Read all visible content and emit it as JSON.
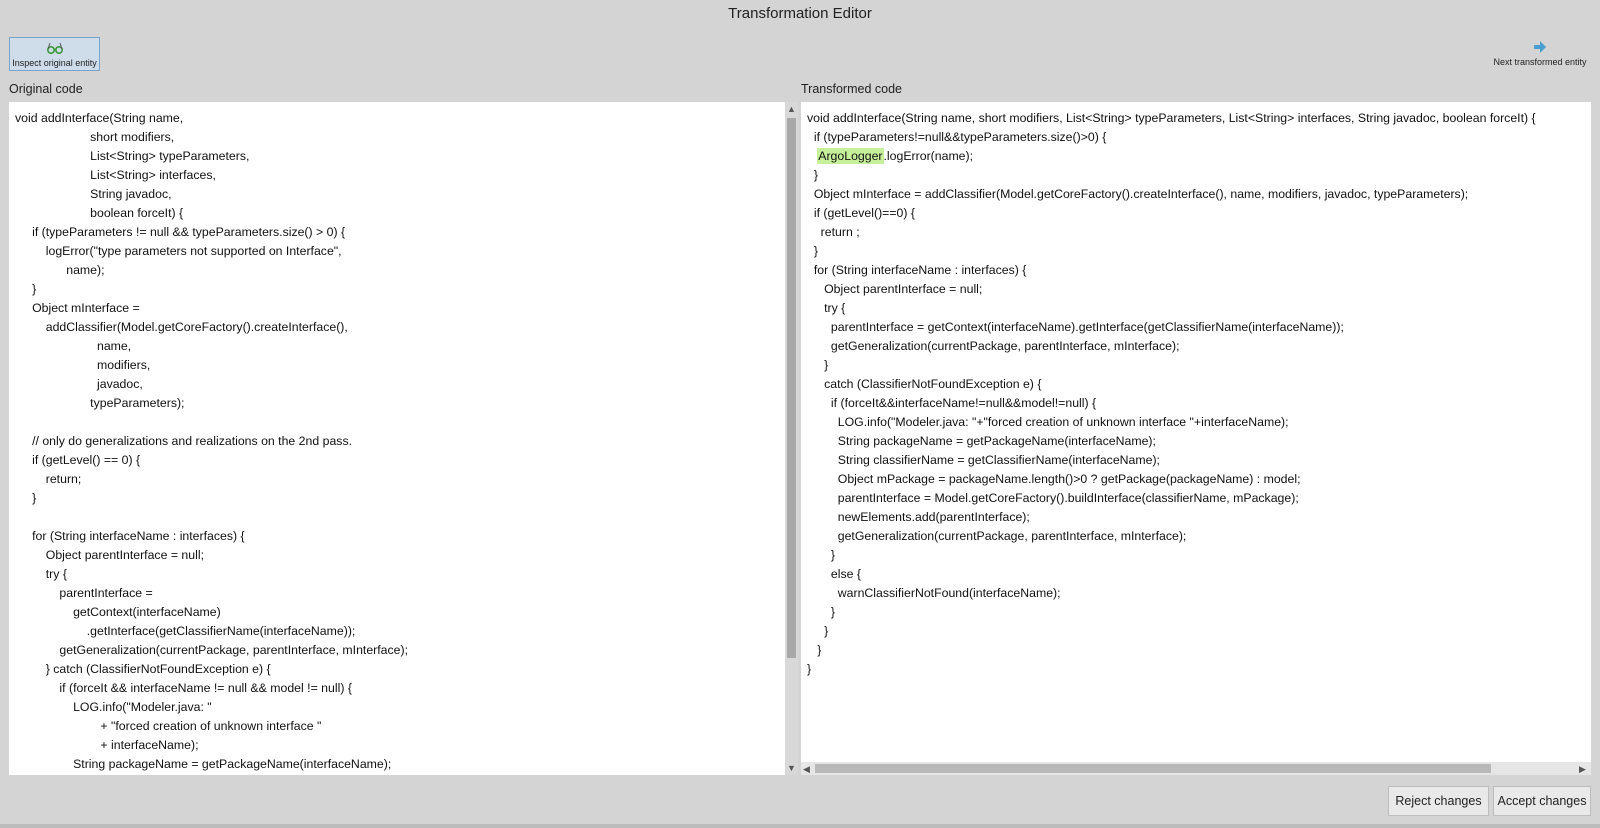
{
  "window": {
    "title": "Transformation Editor"
  },
  "toolbar": {
    "inspect_label": "Inspect original entity",
    "inspect_icon": "glasses-icon",
    "next_label": "Next transformed entity",
    "next_icon": "arrow-right-icon"
  },
  "left_pane": {
    "label": "Original code",
    "code": "void addInterface(String name,\n                      short modifiers,\n                      List<String> typeParameters,\n                      List<String> interfaces,\n                      String javadoc,\n                      boolean forceIt) {\n     if (typeParameters != null && typeParameters.size() > 0) {\n         logError(\"type parameters not supported on Interface\",\n               name);\n     }\n     Object mInterface =\n         addClassifier(Model.getCoreFactory().createInterface(),\n                        name,\n                        modifiers,\n                        javadoc,\n                      typeParameters);\n\n     // only do generalizations and realizations on the 2nd pass.\n     if (getLevel() == 0) {\n         return;\n     }\n\n     for (String interfaceName : interfaces) {\n         Object parentInterface = null;\n         try {\n             parentInterface =\n                 getContext(interfaceName)\n                     .getInterface(getClassifierName(interfaceName));\n             getGeneralization(currentPackage, parentInterface, mInterface);\n         } catch (ClassifierNotFoundException e) {\n             if (forceIt && interfaceName != null && model != null) {\n                 LOG.info(\"Modeler.java: \"\n                         + \"forced creation of unknown interface \"\n                         + interfaceName);\n                 String packageName = getPackageName(interfaceName);"
  },
  "right_pane": {
    "label": "Transformed code",
    "code_before": "void addInterface(String name, short modifiers, List<String> typeParameters, List<String> interfaces, String javadoc, boolean forceIt) {\n  if (typeParameters!=null&&typeParameters.size()>0) {\n   ",
    "highlight": "ArgoLogger",
    "code_after": ".logError(name);\n  }\n  Object mInterface = addClassifier(Model.getCoreFactory().createInterface(), name, modifiers, javadoc, typeParameters);\n  if (getLevel()==0) {\n    return ;\n  }\n  for (String interfaceName : interfaces) {\n     Object parentInterface = null;\n     try {\n       parentInterface = getContext(interfaceName).getInterface(getClassifierName(interfaceName));\n       getGeneralization(currentPackage, parentInterface, mInterface);\n     }\n     catch (ClassifierNotFoundException e) {\n       if (forceIt&&interfaceName!=null&&model!=null) {\n         LOG.info(\"Modeler.java: \"+\"forced creation of unknown interface \"+interfaceName);\n         String packageName = getPackageName(interfaceName);\n         String classifierName = getClassifierName(interfaceName);\n         Object mPackage = packageName.length()>0 ? getPackage(packageName) : model;\n         parentInterface = Model.getCoreFactory().buildInterface(classifierName, mPackage);\n         newElements.add(parentInterface);\n         getGeneralization(currentPackage, parentInterface, mInterface);\n       }\n       else {\n         warnClassifierNotFound(interfaceName);\n       }\n     }\n   }\n}"
  },
  "buttons": {
    "reject": "Reject changes",
    "accept": "Accept changes"
  },
  "colors": {
    "background": "#d4d4d4",
    "highlight": "#c6f09a",
    "accent": "#4a9fd0"
  }
}
